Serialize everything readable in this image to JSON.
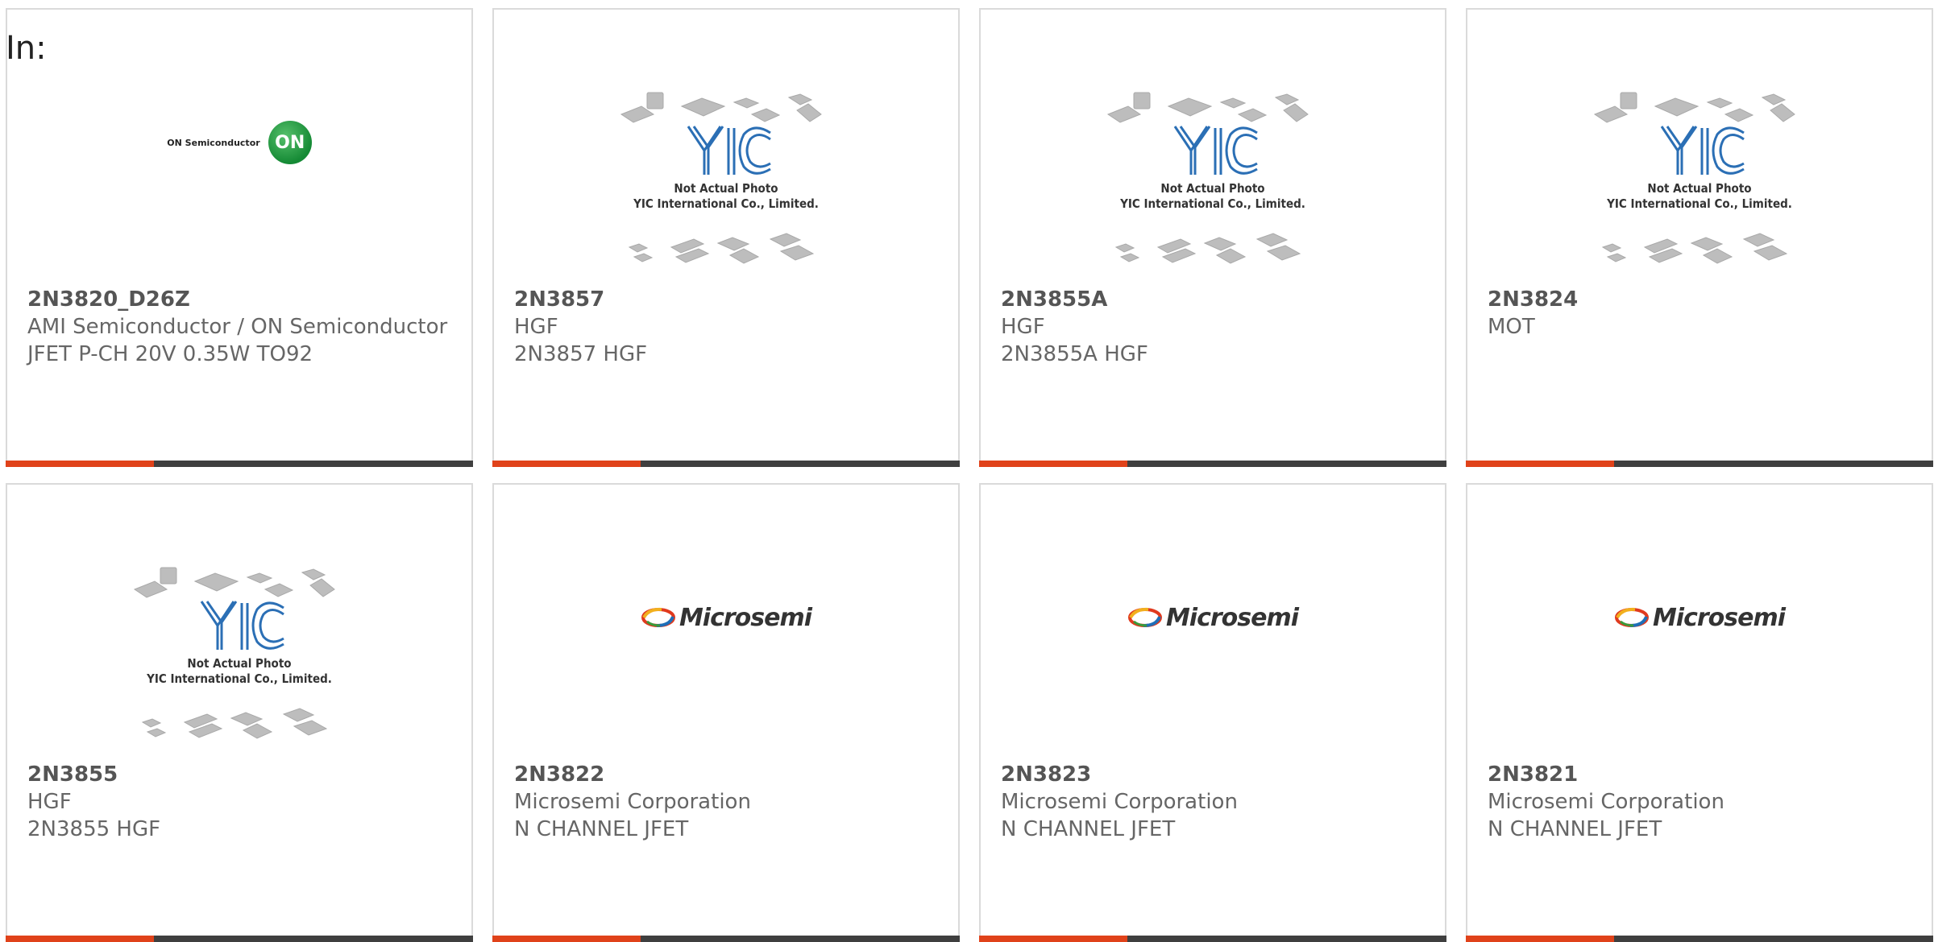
{
  "filter": {
    "label": "In:"
  },
  "placeholder_image": {
    "line1": "Not Actual Photo",
    "line2": "YIC International Co., Limited.",
    "mark": "YIC"
  },
  "logos": {
    "onsemi_text": "ON Semiconductor",
    "onsemi_mark": "ON",
    "microsemi_text": "Microsemi"
  },
  "colors": {
    "accent_bar": "#e0421a",
    "bar_dark": "#3f3f3f",
    "card_border": "#dadada"
  },
  "products": [
    {
      "part": "2N3820_D26Z",
      "image": "onsemi-logo",
      "lines": [
        "AMI Semiconductor / ON Semiconductor",
        "JFET P-CH 20V 0.35W TO92"
      ]
    },
    {
      "part": "2N3857",
      "image": "yic-placeholder",
      "lines": [
        "HGF",
        "2N3857 HGF"
      ]
    },
    {
      "part": "2N3855A",
      "image": "yic-placeholder",
      "lines": [
        "HGF",
        "2N3855A HGF"
      ]
    },
    {
      "part": "2N3824",
      "image": "yic-placeholder",
      "lines": [
        "MOT"
      ]
    },
    {
      "part": "2N3855",
      "image": "yic-placeholder",
      "lines": [
        "HGF",
        "2N3855 HGF"
      ]
    },
    {
      "part": "2N3822",
      "image": "microsemi-logo",
      "lines": [
        "Microsemi Corporation",
        "N CHANNEL JFET"
      ]
    },
    {
      "part": "2N3823",
      "image": "microsemi-logo",
      "lines": [
        "Microsemi Corporation",
        "N CHANNEL JFET"
      ]
    },
    {
      "part": "2N3821",
      "image": "microsemi-logo",
      "lines": [
        "Microsemi Corporation",
        "N CHANNEL JFET"
      ]
    }
  ]
}
